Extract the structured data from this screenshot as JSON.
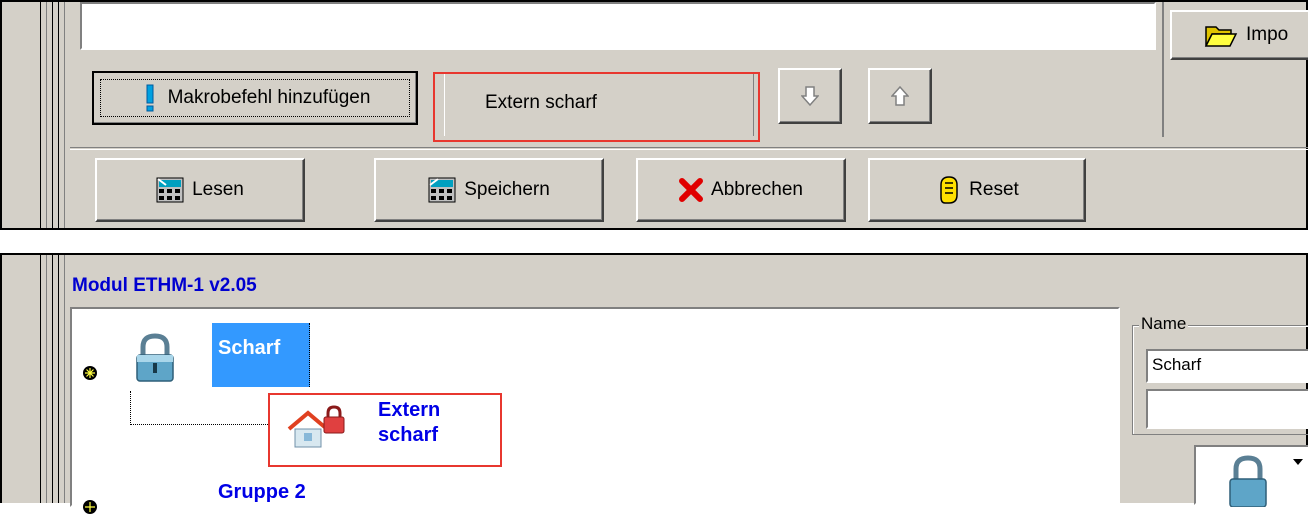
{
  "top_panel": {
    "import_label": "Impo",
    "add_macro_label": "Makrobefehl hinzufügen",
    "dropdown_value": "Extern scharf",
    "move_down_icon": "arrow-down-icon",
    "move_up_icon": "arrow-up-icon",
    "read_label": "Lesen",
    "save_label": "Speichern",
    "cancel_label": "Abbrechen",
    "reset_label": "Reset"
  },
  "bottom_panel": {
    "title": "Modul ETHM-1 v2.05",
    "tree": {
      "node1_label": "Scharf",
      "child_line1": "Extern",
      "child_line2": "scharf",
      "node2_label": "Gruppe 2"
    },
    "name_group_label": "Name",
    "name_value": "Scharf",
    "second_value": ""
  },
  "colors": {
    "panel_bg": "#d4d0c8",
    "highlight_red": "#e8372f",
    "title_blue": "#0000e6",
    "selection_blue": "#3399ff"
  }
}
